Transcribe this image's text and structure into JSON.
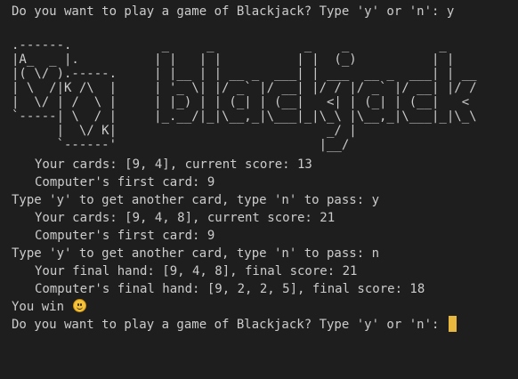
{
  "terminal": {
    "prompt_first": "Do you want to play a game of Blackjack? Type 'y' or 'n': y",
    "ascii_art": ".------.            _     _            _    _            _    \n|A_  _ |.          | |   | |          | |  (_)          | |   \n|( \\/ ).-----.     | |__ | | __ _  ___| | ___  __ _  ___| | __\n| \\  /|K /\\  |     | '_ \\| |/ _` |/ __| |/ / |/ _` |/ __| |/ /\n|  \\/ | /  \\ |     | |_) | | (_| | (__|   <| | (_| | (__|   < \n`-----| \\  / |     |_.__/|_|\\__,_|\\___|_|\\_\\ |\\__,_|\\___|_|\\_\\\n      |  \\/ K|                            _/ |                \n      `------'                           |__/                 ",
    "round1_cards": "Your cards: [9, 4], current score: 13",
    "round1_computer": "Computer's first card: 9",
    "round1_prompt": "Type 'y' to get another card, type 'n' to pass: y",
    "round2_cards": "Your cards: [9, 4, 8], current score: 21",
    "round2_computer": "Computer's first card: 9",
    "round2_prompt": "Type 'y' to get another card, type 'n' to pass: n",
    "final_hand": "Your final hand: [9, 4, 8], final score: 21",
    "computer_final_hand": "Computer's final hand: [9, 2, 2, 5], final score: 18",
    "result": "You win",
    "result_emoji": "smiley-face-icon",
    "prompt_last": "Do you want to play a game of Blackjack? Type 'y' or 'n': "
  },
  "colors": {
    "background": "#1e1e1e",
    "text": "#cccccc",
    "cursor": "#e8b73d"
  }
}
